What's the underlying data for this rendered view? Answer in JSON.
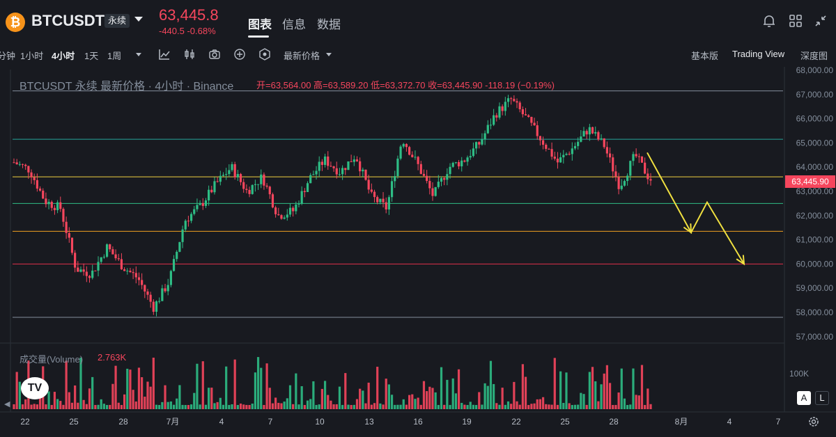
{
  "header": {
    "symbol": "BTCUSDT",
    "contract_badge": "永续",
    "last_price": "63,445.8",
    "change": "-440.5 -0.68%",
    "tabs": [
      {
        "label": "图表",
        "active": true
      },
      {
        "label": "信息",
        "active": false
      },
      {
        "label": "数据",
        "active": false
      }
    ],
    "right_icons": [
      "bell-icon",
      "grid-icon",
      "collapse-icon"
    ]
  },
  "toolbar": {
    "intervals": [
      {
        "label": "分钟",
        "active": false
      },
      {
        "label": "1小时",
        "active": false
      },
      {
        "label": "4小时",
        "active": true
      },
      {
        "label": "1天",
        "active": false
      },
      {
        "label": "1周",
        "active": false
      }
    ],
    "tool_icons": [
      "chevron-down-icon",
      "indicator-icon",
      "candle-type-icon",
      "camera-icon",
      "add-icon",
      "settings-icon"
    ],
    "price_type": "最新价格",
    "view_modes": [
      {
        "label": "基本版",
        "active": false
      },
      {
        "label": "Trading View",
        "active": true
      },
      {
        "label": "深度图",
        "active": false
      }
    ]
  },
  "chart": {
    "legend_title": "BTCUSDT 永续 最新价格 · 4小时 · Binance",
    "legend_ohlc": "开=63,564.00 高=63,589.20 低=63,372.70 收=63,445.90 -118.19 (−0.19%)",
    "current_price_tag": "63,445.90",
    "volume_label": "成交量(Volume)",
    "volume_value": "2.763K",
    "volume_axis_label": "100K",
    "scale_buttons": [
      "A",
      "L"
    ]
  },
  "chart_data": {
    "type": "candlestick",
    "y_axis_ticks": [
      "68,000.00",
      "67,000.00",
      "66,000.00",
      "65,000.00",
      "64,000.00",
      "63,000.00",
      "62,000.00",
      "61,000.00",
      "60,000.00",
      "59,000.00",
      "58,000.00",
      "57,000.00"
    ],
    "ylim": [
      56800,
      68200
    ],
    "x_axis_ticks": [
      "22",
      "25",
      "28",
      "7月",
      "4",
      "7",
      "10",
      "13",
      "16",
      "19",
      "22",
      "25",
      "28",
      "8月",
      "4",
      "7"
    ],
    "horizontal_levels": [
      {
        "price": 67150,
        "color": "#848e9c"
      },
      {
        "price": 65150,
        "color": "#26a69a"
      },
      {
        "price": 63600,
        "color": "#f0d040"
      },
      {
        "price": 62500,
        "color": "#2ebd85"
      },
      {
        "price": 61350,
        "color": "#f0a020"
      },
      {
        "price": 60000,
        "color": "#e0304a"
      },
      {
        "price": 57800,
        "color": "#848e9c"
      }
    ],
    "up_color": "#2ebd85",
    "down_color": "#f6465d",
    "projection_color": "#f0e040",
    "projection_path": [
      {
        "label": "start",
        "price": 64600
      },
      {
        "label": "dip",
        "price": 61300
      },
      {
        "label": "bounce",
        "price": 62550
      },
      {
        "label": "target",
        "price": 60000
      }
    ],
    "trend_anchors": [
      64200,
      63900,
      62600,
      62300,
      59800,
      59600,
      60700,
      59900,
      59400,
      58200,
      59300,
      61800,
      62400,
      63300,
      64000,
      63000,
      63600,
      62000,
      62200,
      63500,
      64300,
      63800,
      64500,
      62800,
      62300,
      65200,
      64100,
      62800,
      64000,
      64300,
      65000,
      66200,
      66800,
      66000,
      65100,
      64200,
      64800,
      65600,
      64900,
      63200,
      64500,
      63446
    ]
  }
}
